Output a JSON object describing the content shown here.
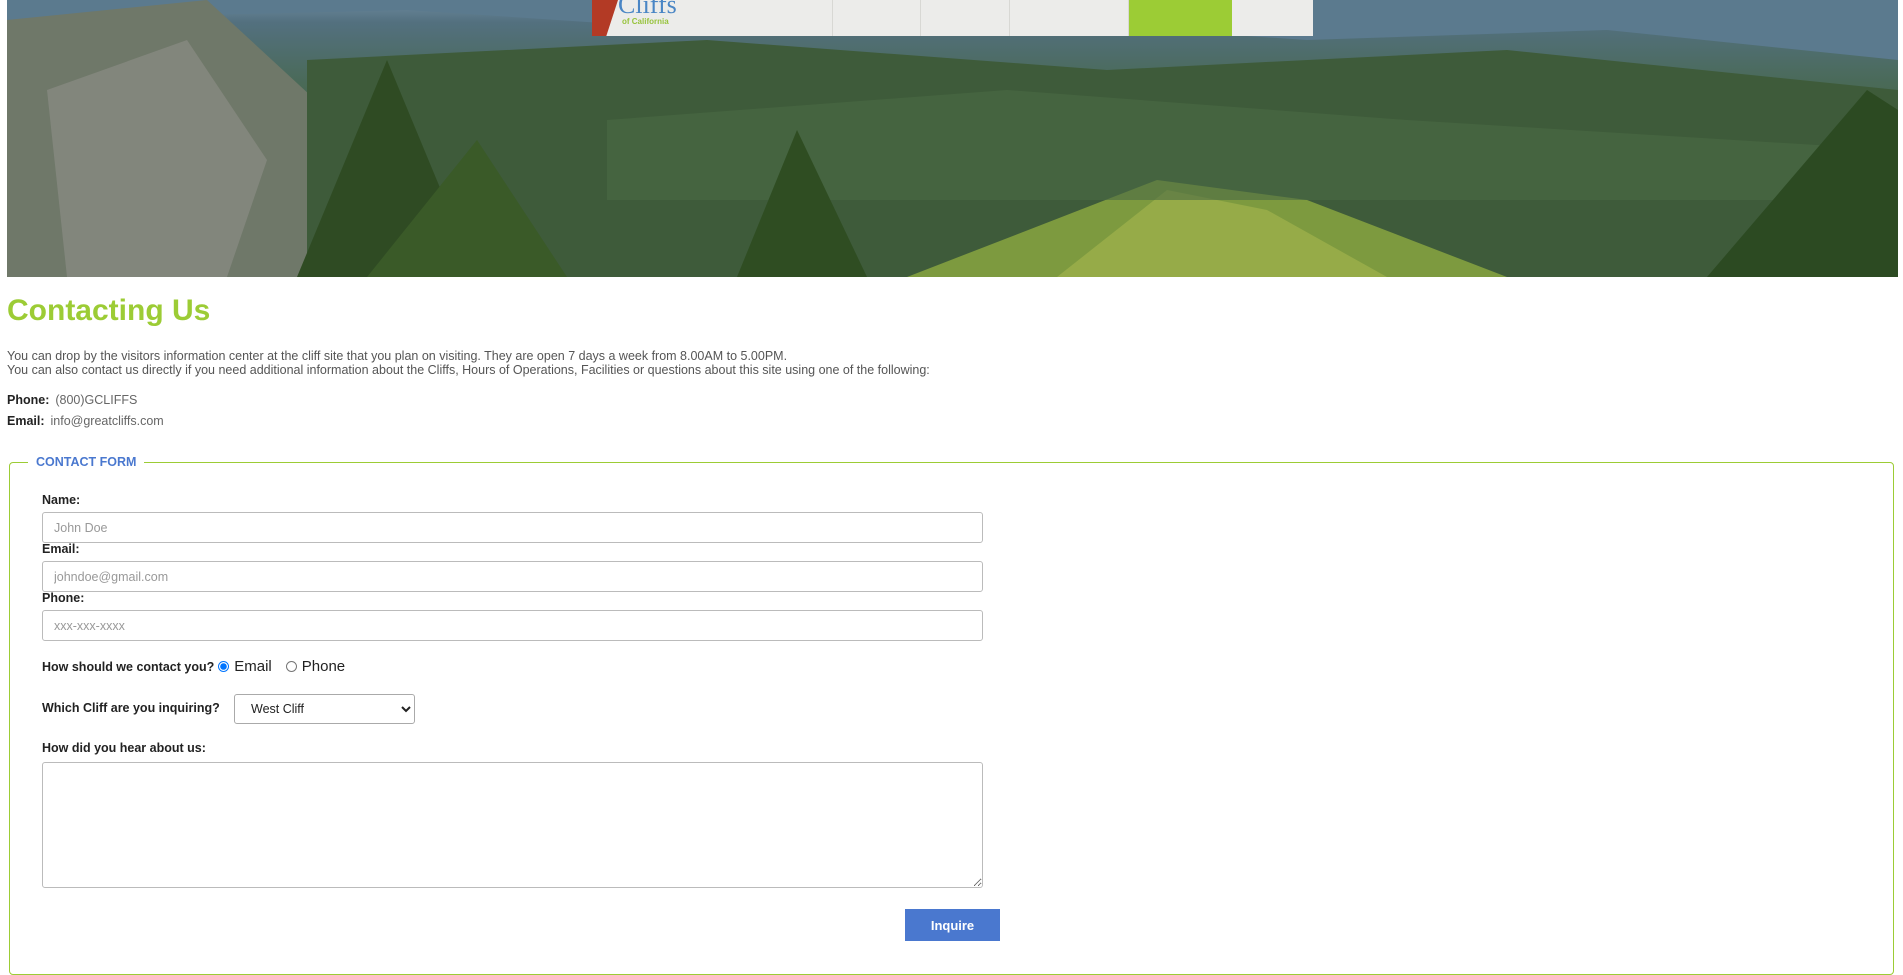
{
  "header": {
    "logo_title": "Cliffs",
    "logo_subtitle": "of California"
  },
  "page": {
    "title": "Contacting Us",
    "intro_line1": "You can drop by the visitors information center at the cliff site that you plan on visiting. They are open 7 days a week from 8.00AM to 5.00PM.",
    "intro_line2": "You can also contact us directly if you need additional information about the Cliffs, Hours of Operations, Facilities or questions about this site using one of the following:"
  },
  "contact": {
    "phone_label": "Phone:",
    "phone_value": "(800)GCLIFFS",
    "email_label": "Email:",
    "email_value": "info@greatcliffs.com"
  },
  "form": {
    "legend": "CONTACT FORM",
    "name_label": "Name:",
    "name_placeholder": "John Doe",
    "email_label": "Email:",
    "email_placeholder": "johndoe@gmail.com",
    "phone_label": "Phone:",
    "phone_placeholder": "xxx-xxx-xxxx",
    "contact_method_question": "How should we contact you?",
    "contact_method_options": [
      "Email",
      "Phone"
    ],
    "contact_method_selected": "Email",
    "cliff_question": "Which Cliff are you inquiring?",
    "cliff_selected": "West Cliff",
    "hear_label": "How did you hear about us:",
    "submit_label": "Inquire"
  },
  "colors": {
    "accent_green": "#9ccc35",
    "accent_blue": "#4a78cf"
  }
}
